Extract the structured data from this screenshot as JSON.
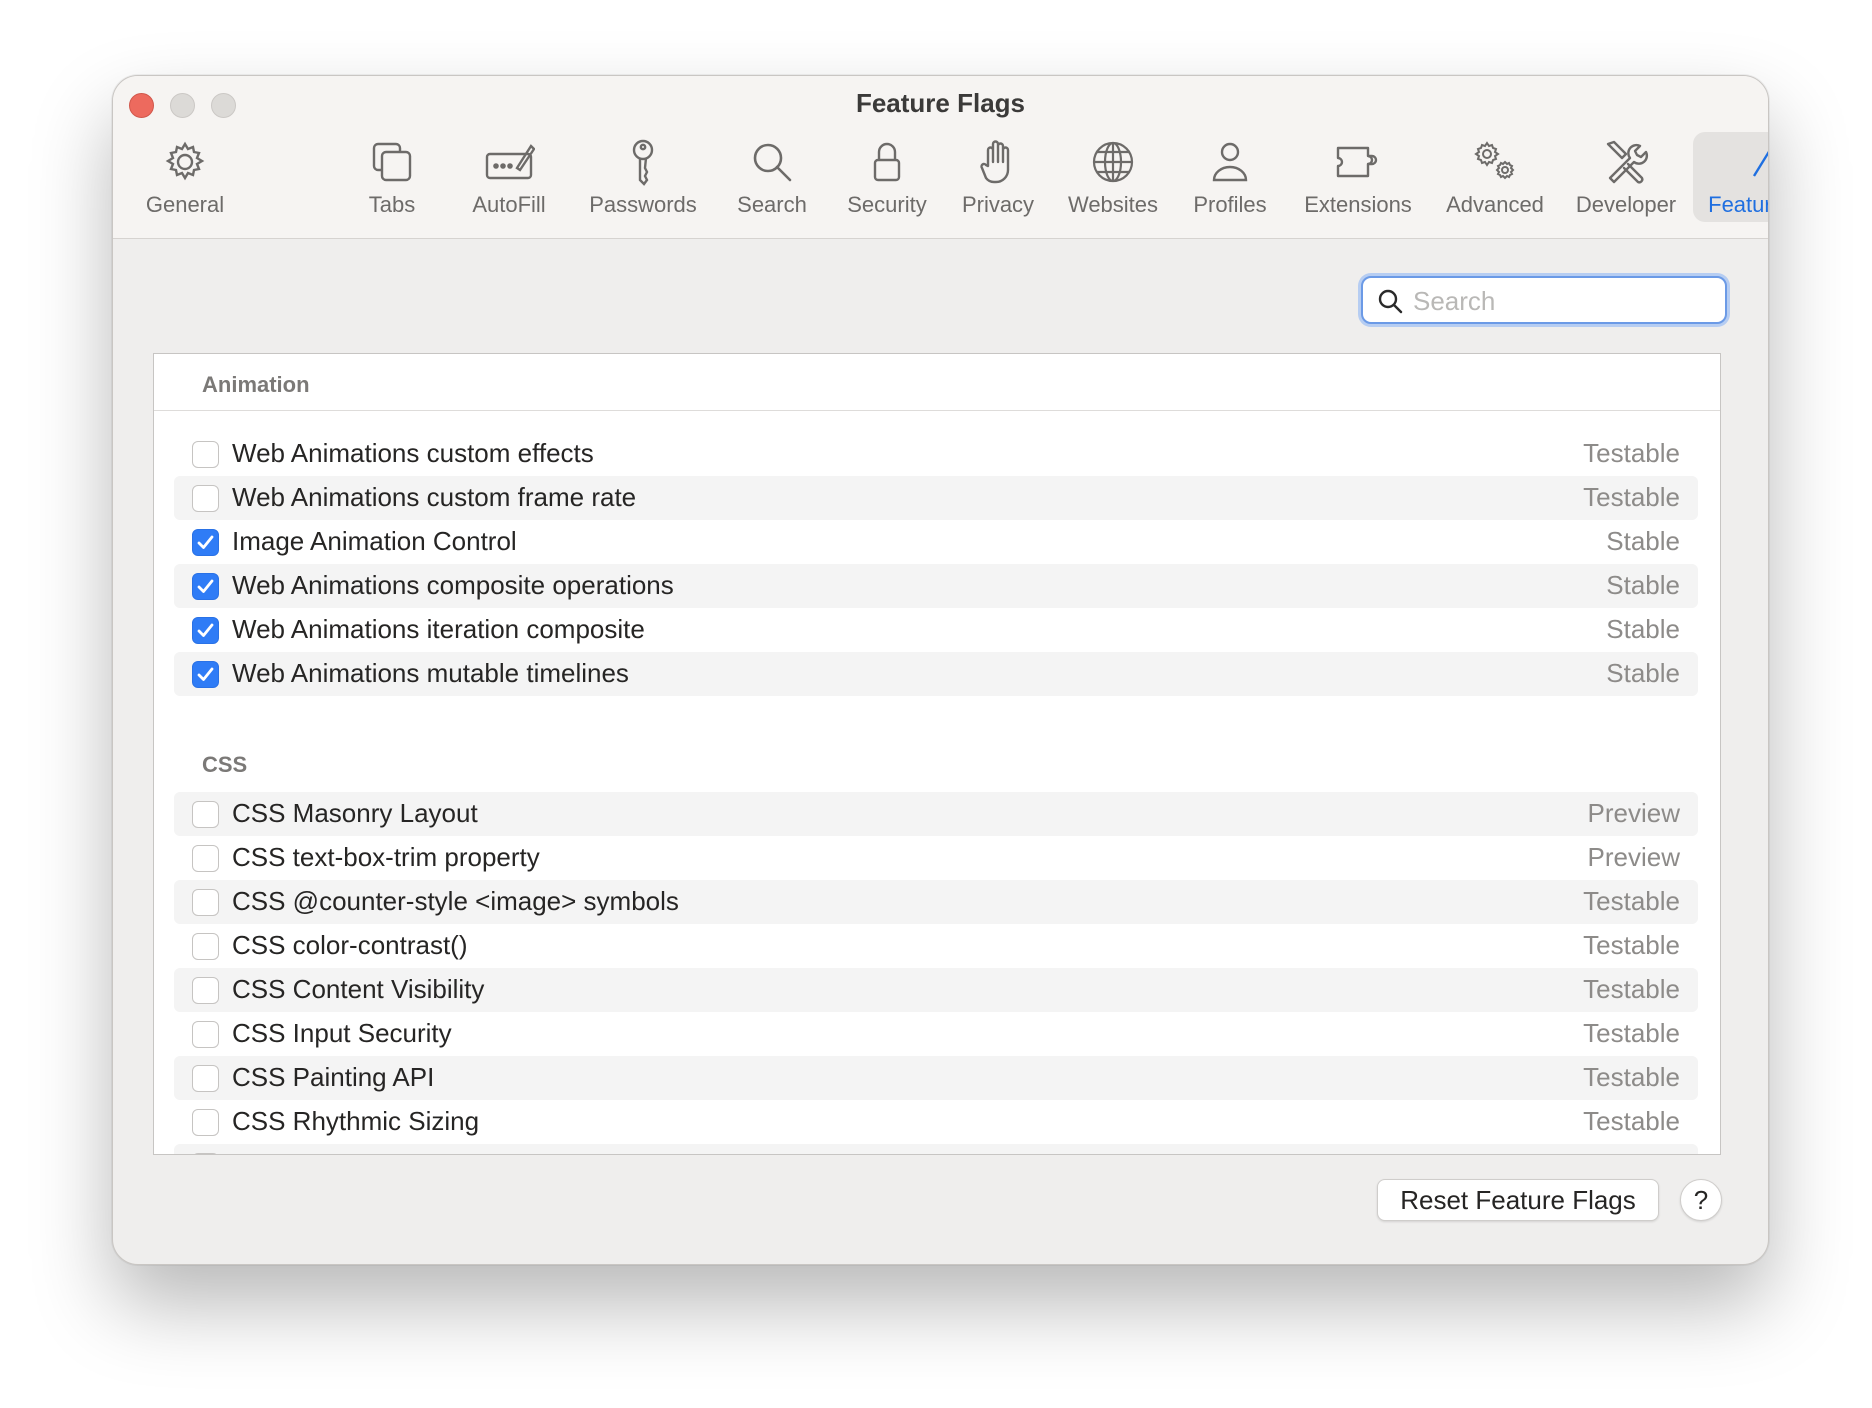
{
  "window": {
    "title": "Feature Flags"
  },
  "toolbar": {
    "tabs": [
      {
        "label": "General",
        "icon": "gear-icon"
      },
      {
        "label": "Tabs",
        "icon": "tabs-icon"
      },
      {
        "label": "AutoFill",
        "icon": "autofill-icon"
      },
      {
        "label": "Passwords",
        "icon": "key-icon"
      },
      {
        "label": "Search",
        "icon": "magnifier-icon"
      },
      {
        "label": "Security",
        "icon": "lock-icon"
      },
      {
        "label": "Privacy",
        "icon": "hand-icon"
      },
      {
        "label": "Websites",
        "icon": "globe-icon"
      },
      {
        "label": "Profiles",
        "icon": "person-icon"
      },
      {
        "label": "Extensions",
        "icon": "puzzle-icon"
      },
      {
        "label": "Advanced",
        "icon": "gears-icon"
      },
      {
        "label": "Developer",
        "icon": "tools-icon"
      },
      {
        "label": "Feature Flags",
        "icon": "flags-icon",
        "active": true
      }
    ]
  },
  "search": {
    "placeholder": "Search",
    "value": ""
  },
  "sections": [
    {
      "title": "Animation",
      "flags": [
        {
          "name": "Web Animations custom effects",
          "status": "Testable",
          "checked": false
        },
        {
          "name": "Web Animations custom frame rate",
          "status": "Testable",
          "checked": false
        },
        {
          "name": "Image Animation Control",
          "status": "Stable",
          "checked": true
        },
        {
          "name": "Web Animations composite operations",
          "status": "Stable",
          "checked": true
        },
        {
          "name": "Web Animations iteration composite",
          "status": "Stable",
          "checked": true
        },
        {
          "name": "Web Animations mutable timelines",
          "status": "Stable",
          "checked": true
        }
      ]
    },
    {
      "title": "CSS",
      "flags": [
        {
          "name": "CSS Masonry Layout",
          "status": "Preview",
          "checked": false
        },
        {
          "name": "CSS text-box-trim property",
          "status": "Preview",
          "checked": false
        },
        {
          "name": "CSS @counter-style <image> symbols",
          "status": "Testable",
          "checked": false
        },
        {
          "name": "CSS color-contrast()",
          "status": "Testable",
          "checked": false
        },
        {
          "name": "CSS Content Visibility",
          "status": "Testable",
          "checked": false
        },
        {
          "name": "CSS Input Security",
          "status": "Testable",
          "checked": false
        },
        {
          "name": "CSS Painting API",
          "status": "Testable",
          "checked": false
        },
        {
          "name": "CSS Rhythmic Sizing",
          "status": "Testable",
          "checked": false
        }
      ]
    }
  ],
  "footer": {
    "reset_label": "Reset Feature Flags",
    "help_label": "?"
  },
  "colors": {
    "accent": "#2f7cf6",
    "active_tab_text": "#1f6fe0",
    "close_button": "#ed6a5e"
  }
}
